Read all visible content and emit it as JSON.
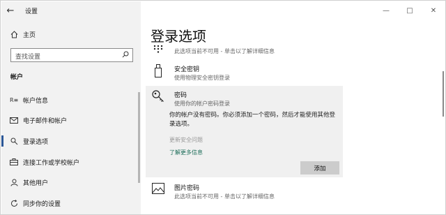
{
  "window": {
    "title": "设置",
    "back_glyph": "←",
    "minimize_glyph": "—",
    "maximize_glyph": "□",
    "close_glyph": "✕"
  },
  "sidebar": {
    "home_label": "主页",
    "search_placeholder": "查找设置",
    "section_title": "帐户",
    "items": [
      {
        "label": "帐户信息",
        "icon": "account-info-icon",
        "active": false
      },
      {
        "label": "电子邮件和帐户",
        "icon": "email-icon",
        "active": false
      },
      {
        "label": "登录选项",
        "icon": "key-icon",
        "active": true
      },
      {
        "label": "连接工作或学校帐户",
        "icon": "briefcase-icon",
        "active": false
      },
      {
        "label": "其他用户",
        "icon": "person-icon",
        "active": false
      },
      {
        "label": "同步你的设置",
        "icon": "sync-icon",
        "active": false
      }
    ]
  },
  "main": {
    "heading": "登录选项",
    "pin_desc": "此选项当前不可用 - 单击以了解详细信息",
    "security_key": {
      "title": "安全密钥",
      "desc": "使用物理安全密钥登录"
    },
    "password": {
      "title": "密码",
      "desc": "使用你的帐户密码登录",
      "message": "你的帐户没有密码。你必须添加一个密码，然后才能使用其他登录选项。",
      "disabled_link": "更新安全问题",
      "learn_more": "了解更多信息",
      "add_button": "添加"
    },
    "picture_password": {
      "title": "图片密码",
      "desc": "此选项当前不可用 - 单击以了解详细信息"
    }
  },
  "colors": {
    "accent": "#2b5797",
    "link": "#1e6e5a",
    "sidebar_bg": "#f2f2f2",
    "card_bg": "#f0f0f0"
  }
}
